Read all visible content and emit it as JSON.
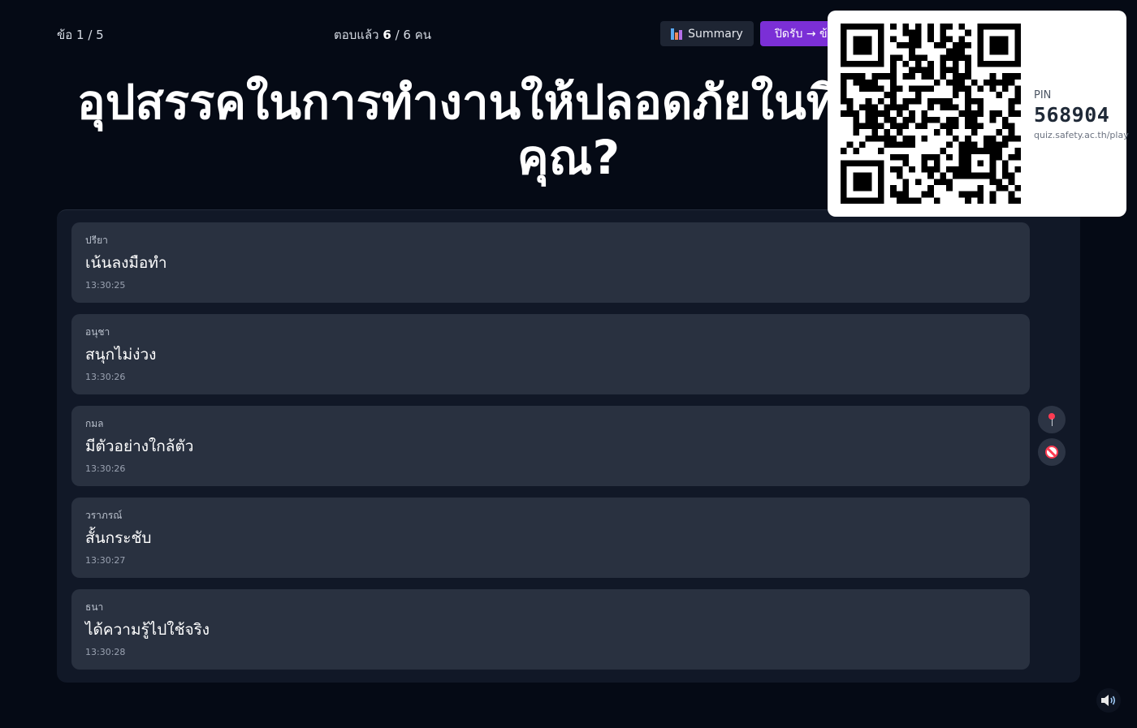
{
  "header": {
    "question_counter": "ข้อ 1 / 5",
    "answered_prefix": "ตอบแล้ว",
    "answered_count": "6",
    "answered_suffix": "/ 6 คน",
    "summary_label": "Summary",
    "close_label": "ปิดรับ → ข้อถัดไป"
  },
  "question": {
    "title": "อุปสรรคในการทำงานให้ปลอดภัยในที่ทำงานของคุณ?"
  },
  "responses": [
    {
      "name": "ปรียา",
      "text": "เน้นลงมือทำ",
      "time": "13:30:25"
    },
    {
      "name": "อนุชา",
      "text": "สนุกไม่ง่วง",
      "time": "13:30:26"
    },
    {
      "name": "กมล",
      "text": "มีตัวอย่างใกล้ตัว",
      "time": "13:30:26"
    },
    {
      "name": "วราภรณ์",
      "text": "สั้นกระชับ",
      "time": "13:30:27"
    },
    {
      "name": "ธนา",
      "text": "ได้ความรู้ไปใช้จริง",
      "time": "13:30:28"
    }
  ],
  "side_actions": {
    "pin_icon": "pushpin-icon",
    "hide_icon": "prohibited-icon"
  },
  "join": {
    "pin_label": "PIN",
    "pin_code": "568904",
    "url": "quiz.safety.ac.th/play"
  },
  "colors": {
    "background": "#050a15",
    "panel": "#111827",
    "card": "#293140",
    "accent": "#7b2fd6"
  }
}
